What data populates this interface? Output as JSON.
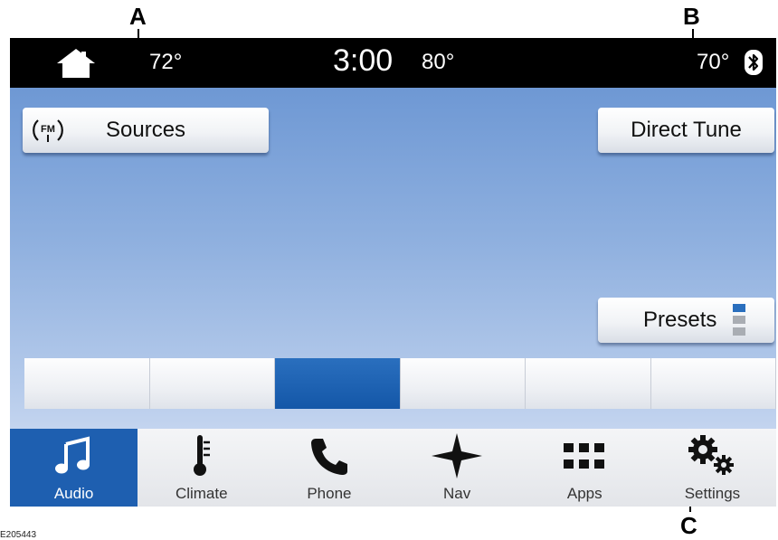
{
  "callouts": {
    "a": "A",
    "b": "B",
    "c": "C"
  },
  "figure_id": "E205443",
  "status_bar": {
    "home_icon": "home-icon",
    "left_temp": "72°",
    "time": "3:00",
    "outside_temp": "80°",
    "right_temp": "70°",
    "bluetooth_icon": "bluetooth-icon"
  },
  "main": {
    "sources_label": "Sources",
    "sources_icon": "fm-radio-icon",
    "direct_tune_label": "Direct Tune",
    "presets_label": "Presets",
    "preset_slots": 6,
    "active_preset_index": 2,
    "colors": {
      "active": "#1457a8",
      "background": "#8fb0df"
    }
  },
  "nav": {
    "items": [
      {
        "label": "Audio",
        "icon": "music-note-icon",
        "active": true
      },
      {
        "label": "Climate",
        "icon": "thermometer-icon",
        "active": false
      },
      {
        "label": "Phone",
        "icon": "phone-icon",
        "active": false
      },
      {
        "label": "Nav",
        "icon": "compass-star-icon",
        "active": false
      },
      {
        "label": "Apps",
        "icon": "apps-grid-icon",
        "active": false
      },
      {
        "label": "Settings",
        "icon": "gears-icon",
        "active": false
      }
    ]
  }
}
